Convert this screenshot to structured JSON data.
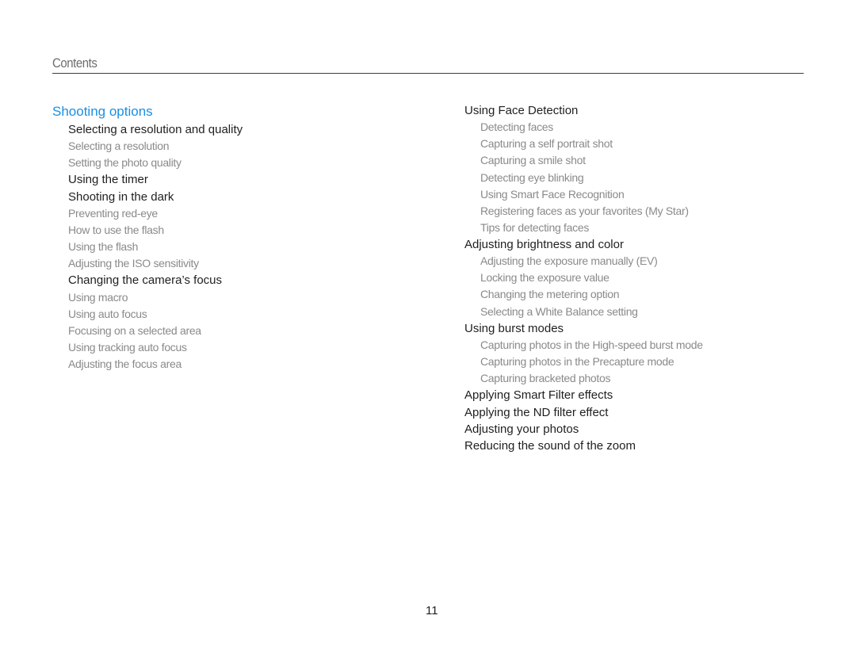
{
  "header": {
    "title": "Contents"
  },
  "left_column": {
    "section_title": "Shooting options",
    "entries": [
      {
        "level": 1,
        "label": "Selecting a resolution and quality"
      },
      {
        "level": 2,
        "label": "Selecting a resolution"
      },
      {
        "level": 2,
        "label": "Setting the photo quality"
      },
      {
        "level": 1,
        "label": "Using the timer"
      },
      {
        "level": 1,
        "label": "Shooting in the dark"
      },
      {
        "level": 2,
        "label": "Preventing red-eye"
      },
      {
        "level": 2,
        "label": "How to use the flash"
      },
      {
        "level": 2,
        "label": "Using the flash"
      },
      {
        "level": 2,
        "label": "Adjusting the ISO sensitivity"
      },
      {
        "level": 1,
        "label": "Changing the camera’s focus"
      },
      {
        "level": 2,
        "label": "Using macro"
      },
      {
        "level": 2,
        "label": "Using auto focus"
      },
      {
        "level": 2,
        "label": "Focusing on a selected area"
      },
      {
        "level": 2,
        "label": "Using tracking auto focus"
      },
      {
        "level": 2,
        "label": "Adjusting the focus area"
      }
    ]
  },
  "right_column": {
    "entries": [
      {
        "level": 1,
        "label": "Using Face Detection"
      },
      {
        "level": 2,
        "label": "Detecting faces"
      },
      {
        "level": 2,
        "label": "Capturing a self portrait shot"
      },
      {
        "level": 2,
        "label": "Capturing a smile shot"
      },
      {
        "level": 2,
        "label": "Detecting eye blinking"
      },
      {
        "level": 2,
        "label": "Using Smart Face Recognition"
      },
      {
        "level": 2,
        "label": "Registering faces as your favorites (My Star)"
      },
      {
        "level": 2,
        "label": "Tips for detecting faces"
      },
      {
        "level": 1,
        "label": "Adjusting brightness and color"
      },
      {
        "level": 2,
        "label": "Adjusting the exposure manually (EV)"
      },
      {
        "level": 2,
        "label": "Locking the exposure value"
      },
      {
        "level": 2,
        "label": "Changing the metering option"
      },
      {
        "level": 2,
        "label": "Selecting a White Balance setting"
      },
      {
        "level": 1,
        "label": "Using burst modes"
      },
      {
        "level": 2,
        "label": "Capturing photos in the High-speed burst mode"
      },
      {
        "level": 2,
        "label": "Capturing photos in the Precapture mode"
      },
      {
        "level": 2,
        "label": "Capturing bracketed photos"
      },
      {
        "level": 1,
        "label": "Applying Smart Filter effects"
      },
      {
        "level": 1,
        "label": "Applying the ND filter effect"
      },
      {
        "level": 1,
        "label": "Adjusting your photos"
      },
      {
        "level": 1,
        "label": "Reducing the sound of the zoom"
      }
    ]
  },
  "footer": {
    "page_number": "11"
  },
  "colors": {
    "section_title": "#1a8fe3",
    "level1_text": "#1f1f1f",
    "level2_text": "#8a8a8a",
    "header_text": "#6d6d6d"
  }
}
